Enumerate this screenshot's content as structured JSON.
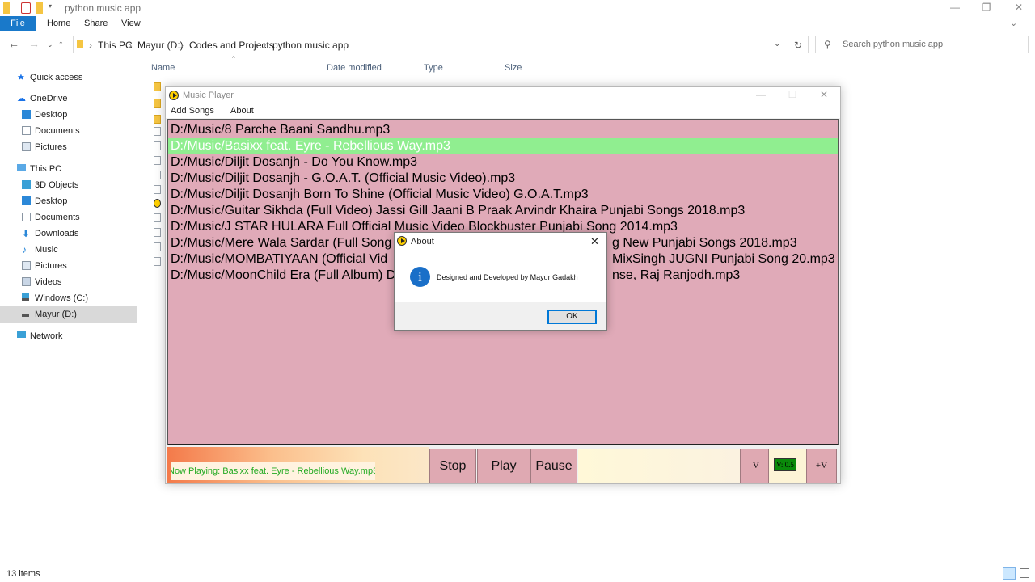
{
  "explorer": {
    "title": "python music app",
    "ribbon_tabs": [
      "File",
      "Home",
      "Share",
      "View"
    ],
    "breadcrumb": [
      "This PC",
      "Mayur (D:)",
      "Codes and Projects",
      "python music app"
    ],
    "search_placeholder": "Search python music app",
    "columns": [
      "Name",
      "Date modified",
      "Type",
      "Size"
    ],
    "status_count": "13 items",
    "nav": [
      {
        "label": "Quick access",
        "icon": "star-icon"
      },
      {
        "label": "OneDrive",
        "icon": "cloud-icon"
      },
      {
        "label": "Desktop",
        "icon": "desktop-icon"
      },
      {
        "label": "Documents",
        "icon": "documents-icon"
      },
      {
        "label": "Pictures",
        "icon": "pictures-icon"
      },
      {
        "label": "This PC",
        "icon": "computer-icon"
      },
      {
        "label": "3D Objects",
        "icon": "cube-icon"
      },
      {
        "label": "Desktop",
        "icon": "desktop-icon"
      },
      {
        "label": "Documents",
        "icon": "documents-icon"
      },
      {
        "label": "Downloads",
        "icon": "download-icon"
      },
      {
        "label": "Music",
        "icon": "music-icon"
      },
      {
        "label": "Pictures",
        "icon": "pictures-icon"
      },
      {
        "label": "Videos",
        "icon": "videos-icon"
      },
      {
        "label": "Windows (C:)",
        "icon": "drive-icon"
      },
      {
        "label": "Mayur (D:)",
        "icon": "drive-icon",
        "selected": true
      },
      {
        "label": "Network",
        "icon": "network-icon"
      }
    ]
  },
  "player": {
    "window_title": "Music Player",
    "menu": [
      "Add Songs",
      "About"
    ],
    "songs": [
      "D:/Music/8 Parche Baani Sandhu.mp3",
      "D:/Music/Basixx feat. Eyre - Rebellious Way.mp3",
      "D:/Music/Diljit Dosanjh - Do You Know.mp3",
      "D:/Music/Diljit Dosanjh - G.O.A.T. (Official Music Video).mp3",
      "D:/Music/Diljit Dosanjh Born To Shine (Official Music Video) G.O.A.T.mp3",
      "D:/Music/Guitar Sikhda (Full Video) Jassi Gill Jaani B Praak Arvindr Khaira Punjabi Songs 2018.mp3",
      "D:/Music/J STAR HULARA Full Official Music Video Blockbuster Punjabi Song 2014.mp3",
      "D:/Music/Mere Wala Sardar (Full Song",
      "D:/Music/MOMBATIYAAN (Official Vid",
      "D:/Music/MoonChild Era (Full Album) D"
    ],
    "songs_tail": {
      "7": "g New Punjabi Songs 2018.mp3",
      "8": "MixSingh JUGNI Punjabi Song 20.mp3",
      "9": "nse, Raj Ranjodh.mp3"
    },
    "selected_index": 1,
    "now_playing": "Now Playing: Basixx feat. Eyre - Rebellious Way.mp3",
    "buttons": {
      "stop": "Stop",
      "play": "Play",
      "pause": "Pause",
      "vol_down": "-V",
      "vol_up": "+V"
    },
    "volume_label": "V: 0.5"
  },
  "dialog": {
    "title": "About",
    "message": "Designed and Developed by Mayur Gadakh",
    "ok": "OK"
  },
  "colors": {
    "playlist_bg": "#e0aab8",
    "selected_song_bg": "#90ee90",
    "file_tab": "#1979ca"
  }
}
